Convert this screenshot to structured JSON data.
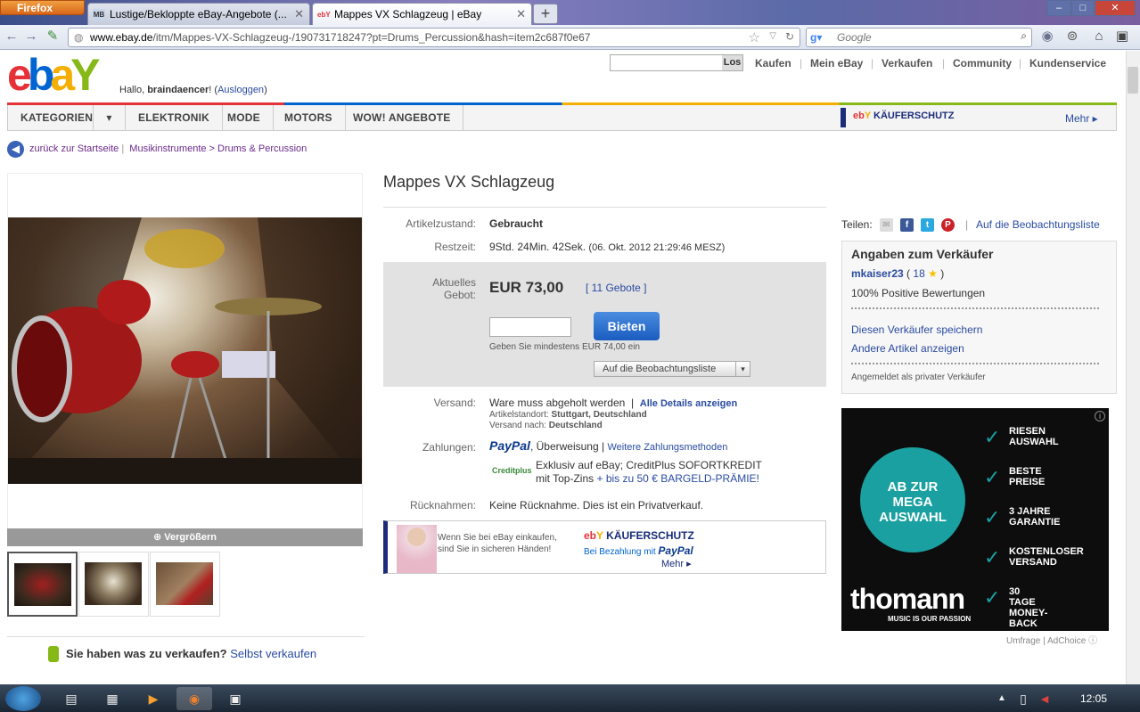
{
  "browser": {
    "app_button": "Firefox",
    "tabs": [
      {
        "favicon": "MB",
        "label": "Lustige/Bekloppte eBay-Angebote (..."
      },
      {
        "favicon": "ebY",
        "label": "Mappes VX Schlagzeug | eBay"
      }
    ],
    "url_host": "www.ebay.de",
    "url_path": "/itm/Mappes-VX-Schlagzeug-/190731718247?pt=Drums_Percussion&hash=item2c687f0e67",
    "search_placeholder": "Google"
  },
  "header": {
    "hello_prefix": "Hallo, ",
    "username": "braindaencer",
    "logout": "Ausloggen",
    "search_button": "Los",
    "links": [
      "Kaufen",
      "Mein eBay",
      "Verkaufen",
      "Community",
      "Kundenservice"
    ]
  },
  "categories": {
    "items": [
      "KATEGORIEN",
      "ELEKTRONIK",
      "MODE",
      "MOTORS",
      "WOW! ANGEBOTE"
    ],
    "kaeuferschutz": "KÄUFERSCHUTZ",
    "more": "Mehr ▸"
  },
  "breadcrumb": {
    "back": "zurück zur Startseite",
    "path": "Musikinstrumente > Drums & Percussion"
  },
  "gallery": {
    "enlarge": "Vergrößern",
    "sell_question": "Sie haben was zu verkaufen?",
    "sell_link": "Selbst verkaufen"
  },
  "item": {
    "title": "Mappes VX Schlagzeug",
    "condition_label": "Artikelzustand:",
    "condition": "Gebraucht",
    "time_label": "Restzeit:",
    "time_left": "9Std. 24Min. 42Sek.",
    "end_date": "(06. Okt. 2012 21:29:46 MESZ)",
    "bid_label_1": "Aktuelles",
    "bid_label_2": "Gebot:",
    "price": "EUR 73,00",
    "bids": "11 Gebote",
    "bid_button": "Bieten",
    "min_bid": "Geben Sie mindestens EUR 74,00 ein",
    "watch_button": "Auf die Beobachtungsliste",
    "shipping_label": "Versand:",
    "shipping": "Ware muss abgeholt werden",
    "shipping_details": "Alle Details anzeigen",
    "location_label": "Artikelstandort:",
    "location": "Stuttgart, Deutschland",
    "ship_to_label": "Versand nach:",
    "ship_to": "Deutschland",
    "payment_label": "Zahlungen:",
    "paypal": "PayPal",
    "payment_other": ", Überweisung",
    "payment_more": "Weitere Zahlungsmethoden",
    "creditplus": "Creditplus",
    "credit_text_1": "Exklusiv auf eBay; CreditPlus SOFORTKREDIT",
    "credit_text_2": "mit Top-Zins",
    "credit_link": "+ bis zu 50 € BARGELD-PRÄMIE!",
    "returns_label": "Rücknahmen:",
    "returns": "Keine Rücknahme. Dies ist ein Privatverkauf."
  },
  "banner": {
    "text_1": "Wenn Sie bei eBay einkaufen,",
    "text_2": "sind Sie in sicheren Händen!",
    "brand": "KÄUFERSCHUTZ",
    "sub": "Bei Bezahlung mit",
    "paypal": "PayPal",
    "more": "Mehr ▸"
  },
  "seller": {
    "share_label": "Teilen:",
    "watch_link": "Auf die Beobachtungsliste",
    "heading": "Angaben zum Verkäufer",
    "name": "mkaiser23",
    "score": "18",
    "positive": "100% Positive Bewertungen",
    "save": "Diesen Verkäufer speichern",
    "other": "Andere Artikel anzeigen",
    "private": "Angemeldet als privater Verkäufer"
  },
  "ad": {
    "circle_1": "AB ZUR",
    "circle_2": "MEGA",
    "circle_3": "AUSWAHL",
    "points": [
      [
        "RIESEN",
        "AUSWAHL"
      ],
      [
        "BESTE",
        "PREISE"
      ],
      [
        "3 JAHRE",
        "GARANTIE"
      ],
      [
        "KOSTENLOSER",
        "VERSAND"
      ],
      [
        "30 TAGE",
        "MONEY-BACK"
      ]
    ],
    "brand": "thomann",
    "tagline": "MUSIC IS OUR PASSION",
    "footer_1": "Umfrage",
    "footer_2": "AdChoice"
  },
  "taskbar": {
    "clock": "12:05"
  },
  "colors": {
    "ebay_red": "#e53238",
    "ebay_blue": "#0064d2",
    "ebay_yellow": "#f5af02",
    "ebay_green": "#86b817",
    "link": "#2a4ba0",
    "bid_button": "#1a5cc0",
    "thomann_teal": "#1aa0a0"
  }
}
